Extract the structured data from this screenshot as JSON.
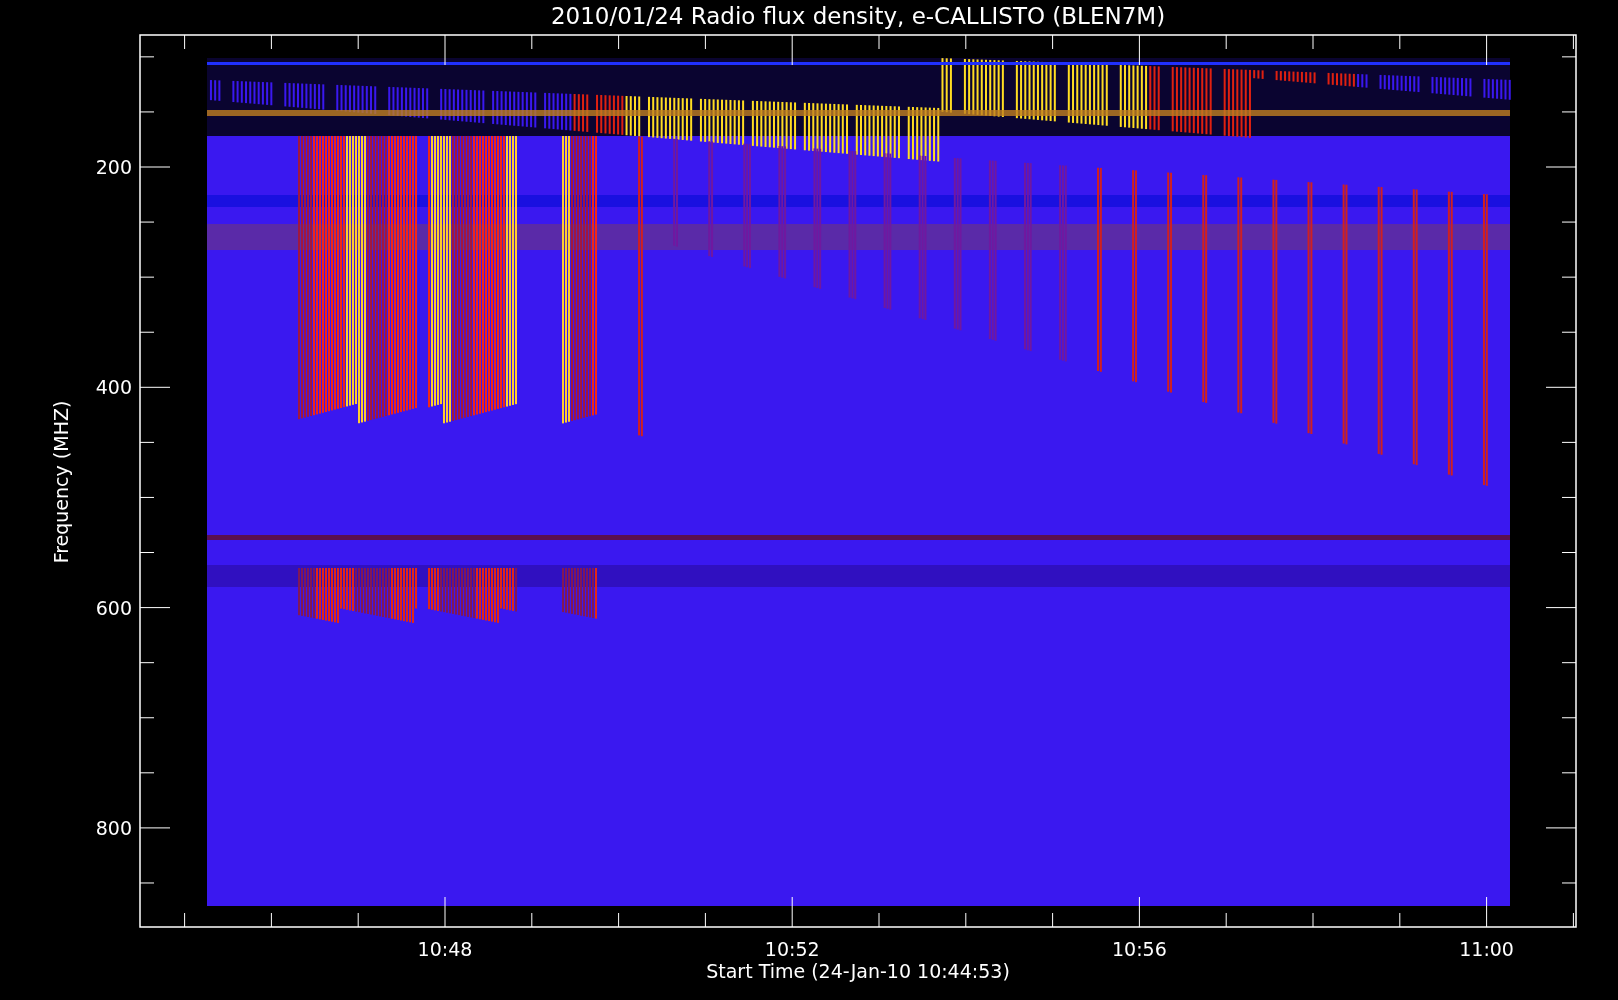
{
  "title": "2010/01/24  Radio flux density, e-CALLISTO (BLEN7M)",
  "y_axis": {
    "label": "Frequency (MHZ)",
    "ticks": [
      "200",
      "400",
      "600",
      "800"
    ]
  },
  "x_axis": {
    "label": "Start Time (24-Jan-10 10:44:53)",
    "ticks": [
      "10:48",
      "10:52",
      "10:56",
      "11:00"
    ]
  }
}
